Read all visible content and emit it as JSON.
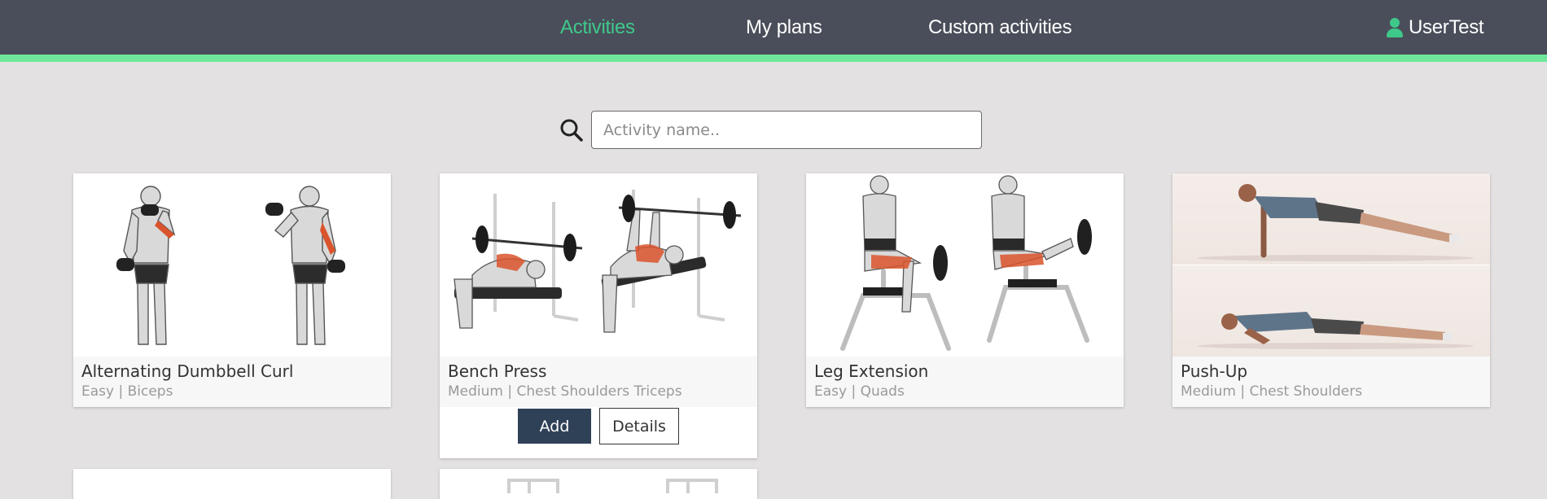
{
  "nav": {
    "links": [
      {
        "label": "Activities",
        "active": true
      },
      {
        "label": "My plans",
        "active": false
      },
      {
        "label": "Custom activities",
        "active": false
      }
    ],
    "user": {
      "label": "UserTest",
      "icon": "user-icon"
    },
    "accent_color": "#6fe79a",
    "active_color": "#3ec98a"
  },
  "search": {
    "icon": "search-icon",
    "placeholder": "Activity name..",
    "value": ""
  },
  "activities": [
    {
      "title": "Alternating Dumbbell Curl",
      "difficulty": "Easy",
      "muscles": "Biceps",
      "subtitle": "Easy | Biceps"
    },
    {
      "title": "Bench Press",
      "difficulty": "Medium",
      "muscles": "Chest Shoulders Triceps",
      "subtitle": "Medium | Chest Shoulders Triceps",
      "actions": {
        "add": "Add",
        "details": "Details"
      }
    },
    {
      "title": "Leg Extension",
      "difficulty": "Easy",
      "muscles": "Quads",
      "subtitle": "Easy | Quads"
    },
    {
      "title": "Push-Up",
      "difficulty": "Medium",
      "muscles": "Chest Shoulders",
      "subtitle": "Medium | Chest Shoulders"
    }
  ],
  "colors": {
    "background": "#e3e1e1",
    "navbar": "#4a4e5a",
    "add_button": "#2f4157",
    "muscle_highlight": "#d9542c"
  }
}
